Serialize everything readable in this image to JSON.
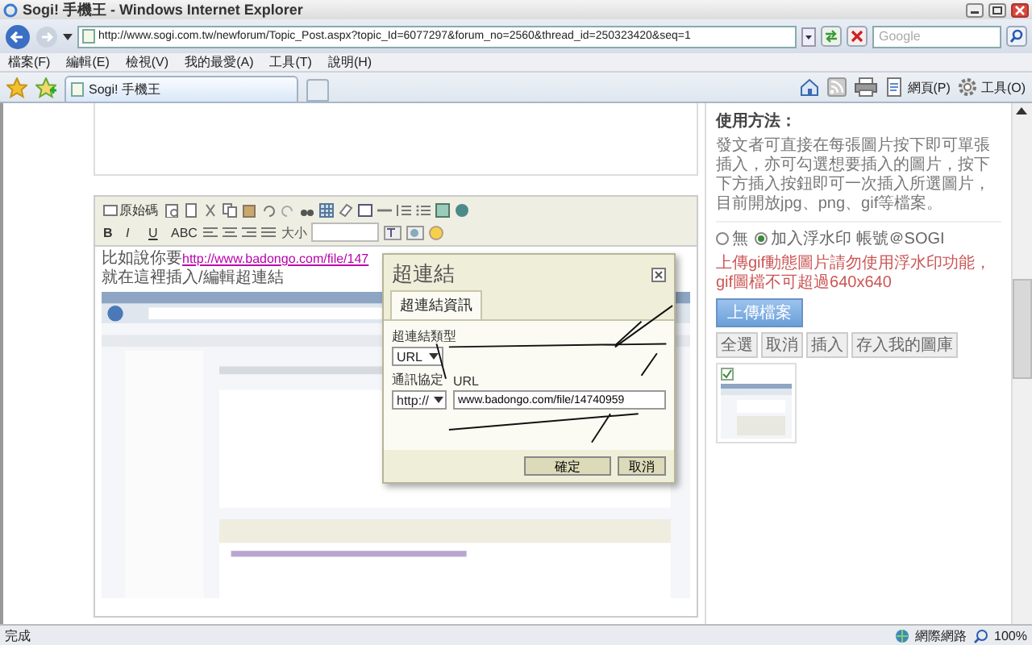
{
  "window": {
    "title": "Sogi! 手機王 - Windows Internet Explorer"
  },
  "address_bar": {
    "url": "http://www.sogi.com.tw/newforum/Topic_Post.aspx?topic_Id=6077297&forum_no=2560&thread_id=250323420&seq=1",
    "search_placeholder": "Google"
  },
  "menu": [
    "檔案(F)",
    "編輯(E)",
    "檢視(V)",
    "我的最愛(A)",
    "工具(T)",
    "說明(H)"
  ],
  "tabs": [
    {
      "label": "Sogi! 手機王",
      "selected": true
    }
  ],
  "command_bar": [
    "網頁(P)",
    "工具(O)"
  ],
  "editor": {
    "source_button": "原始碼",
    "format_buttons": [
      "B",
      "I",
      "U",
      "ABC"
    ],
    "size_label": "大小",
    "lines": [
      {
        "text": "比如說你要",
        "link": "http://www.badongo.com/file/147"
      },
      {
        "text": "就在這裡插入/編輯超連結"
      }
    ],
    "image": {
      "kind": "picture"
    }
  },
  "dialog": {
    "title": "超連結",
    "tabs": [
      {
        "label": "超連結資訊",
        "selected": true
      }
    ],
    "link_type": {
      "label": "超連結類型",
      "value": "URL"
    },
    "protocol": {
      "label": "通訊協定",
      "value": "http://"
    },
    "url": {
      "label": "URL",
      "value": "www.badongo.com/file/14740959"
    },
    "buttons": [
      "確定",
      "取消"
    ]
  },
  "side_panel": {
    "heading": "使用方法：",
    "description": "發文者可直接在每張圖片按下即可單張插入，亦可勾選想要插入的圖片，按下下方插入按鈕即可一次插入所選圖片，目前開放jpg、png、gif等檔案。",
    "watermark_options": [
      {
        "label": "無",
        "selected": false
      },
      {
        "label": "加入浮水印 帳號＠SOGI",
        "selected": true
      }
    ],
    "warning": "上傳gif動態圖片請勿使用浮水印功能，gif圖檔不可超過640x640",
    "upload_button": "上傳檔案",
    "actions": [
      "全選",
      "取消",
      "插入",
      "存入我的圖庫"
    ],
    "thumbnails": [
      {
        "kind": "picture",
        "checked": true
      }
    ]
  },
  "status_bar": {
    "text": "完成",
    "zone": "網際網路",
    "zoom": "100%"
  }
}
